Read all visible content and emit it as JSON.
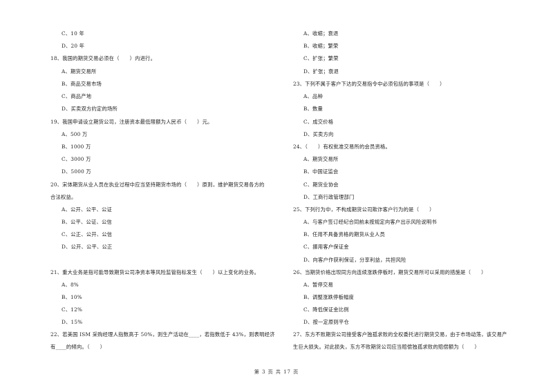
{
  "left_column": [
    {
      "type": "option",
      "text": "C、10 年"
    },
    {
      "type": "option",
      "text": "D、20 年"
    },
    {
      "type": "question",
      "text": "18、我国的期货交易必须在（　　）内进行。"
    },
    {
      "type": "option",
      "text": "A、期货交易所"
    },
    {
      "type": "option",
      "text": "B、商品交易市场"
    },
    {
      "type": "option",
      "text": "C、商品产地"
    },
    {
      "type": "option",
      "text": "D、买卖双方约定的场所"
    },
    {
      "type": "question",
      "text": "19、我国申请设立期货公司，注册资本最低限额为人民币（　　）元。"
    },
    {
      "type": "option",
      "text": "A、500 万"
    },
    {
      "type": "option",
      "text": "B、1000 万"
    },
    {
      "type": "option",
      "text": "C、3000 万"
    },
    {
      "type": "option",
      "text": "D、5000 万"
    },
    {
      "type": "question",
      "text": "20、宋体期货从业人员在执业过程中应当坚持期货市场的（　　）原则，维护期货交易各方的"
    },
    {
      "type": "question",
      "text": "合法权益。"
    },
    {
      "type": "option",
      "text": "A、公开、公平、公证"
    },
    {
      "type": "option",
      "text": "B、公平、公证、公信"
    },
    {
      "type": "option",
      "text": "C、公正、公开、公信"
    },
    {
      "type": "option",
      "text": "D、公开、公平、公正"
    },
    {
      "type": "question",
      "text": "21、重大业务是指可能导致期货公司净资本等风险监管指标发生（　　）以上变化的业务。"
    },
    {
      "type": "option",
      "text": "A、8%"
    },
    {
      "type": "option",
      "text": "B、10%"
    },
    {
      "type": "option",
      "text": "C、12%"
    },
    {
      "type": "option",
      "text": "D、15%"
    },
    {
      "type": "question",
      "text": "22、若美国 ISM 采购经理人指数高于 50%，则生产活动在____，若指数低于 43%，则表明经济"
    },
    {
      "type": "question",
      "text": "有____的倾向。（　　）"
    }
  ],
  "right_column": [
    {
      "type": "option",
      "text": "A、收缩；衰退"
    },
    {
      "type": "option",
      "text": "B、收缩；繁荣"
    },
    {
      "type": "option",
      "text": "C、扩张；繁荣"
    },
    {
      "type": "option",
      "text": "D、扩张；衰退"
    },
    {
      "type": "question",
      "text": "23、下列不属于客户下达的交易指令中必须包括的事项是（　　）"
    },
    {
      "type": "option",
      "text": "A、品种"
    },
    {
      "type": "option",
      "text": "B、数量"
    },
    {
      "type": "option",
      "text": "C、成交价格"
    },
    {
      "type": "option",
      "text": "D、买卖方向"
    },
    {
      "type": "question",
      "text": "24、（　　）有权批准交易所的会员资格。"
    },
    {
      "type": "option",
      "text": "A、期货交易所"
    },
    {
      "type": "option",
      "text": "B、中国证监会"
    },
    {
      "type": "option",
      "text": "C、期货业协会"
    },
    {
      "type": "option",
      "text": "D、工商行政管理部门"
    },
    {
      "type": "question",
      "text": "25、下列行为中，不构成期货公司欺诈客户行为的是（　　）"
    },
    {
      "type": "option",
      "text": "A、与客户签订经纪合同前未按规定向客户出示风险说明书"
    },
    {
      "type": "option",
      "text": "B、任用不具备资格的期货从业人员"
    },
    {
      "type": "option",
      "text": "C、挪用客户保证金"
    },
    {
      "type": "option",
      "text": "D、向客户作获利保证，分享利益，共担风险"
    },
    {
      "type": "question",
      "text": "26、当期货价格出现同方向连续涨跌停板时，期货交易所可以采用的措施是（　　）"
    },
    {
      "type": "option",
      "text": "A、暂停交易"
    },
    {
      "type": "option",
      "text": "B、调整涨跌停板幅度"
    },
    {
      "type": "option",
      "text": "C、降低保证金比例"
    },
    {
      "type": "option",
      "text": "D、按一定原则平仓"
    },
    {
      "type": "question",
      "text": "27、东方不败期货公司接受客户独孤求败的全权委托进行期货交易，由于市场动荡，该交易产"
    },
    {
      "type": "question",
      "text": "生巨大损失。对此损失，东方不败期货公司应当赔偿独孤求败的赔偿额为（　　）"
    }
  ],
  "footer": {
    "page_label": "第 3 页 共 17 页"
  }
}
